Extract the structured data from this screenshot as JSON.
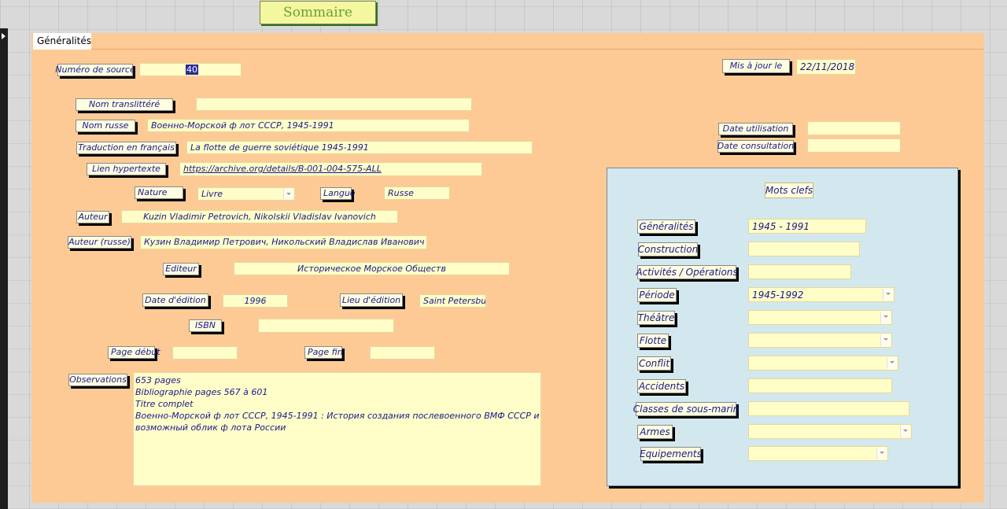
{
  "nav": {
    "sommaire_label": "Sommaire"
  },
  "tab": {
    "label": "Généralités"
  },
  "form": {
    "source_num": {
      "label": "Numéro de source",
      "value": "40"
    },
    "updated": {
      "label": "Mis à jour le",
      "value": "22/11/2018"
    },
    "nom_translit": {
      "label": "Nom translittéré",
      "value": ""
    },
    "nom_russe": {
      "label": "Nom russe",
      "value": "Военно-Морской ф лот СССР, 1945-1991"
    },
    "traduction": {
      "label": "Traduction en français",
      "value": "La flotte de guerre soviétique 1945-1991"
    },
    "lien": {
      "label": "Lien hypertexte",
      "value": "https://archive.org/details/B-001-004-575-ALL"
    },
    "nature": {
      "label": "Nature",
      "value": "Livre"
    },
    "langue": {
      "label": "Langue",
      "value": "Russe"
    },
    "auteur": {
      "label": "Auteur",
      "value": "Kuzin Vladimir Petrovich, Nikolskii Vladislav Ivanovich"
    },
    "auteur_russe": {
      "label": "Auteur (russe)",
      "value": "Кузин Владимир Петрович, Никольский Владислав Иванович"
    },
    "editeur": {
      "label": "Editeur",
      "value": "Историческое Морское Обществ"
    },
    "date_edition": {
      "label": "Date d'édition",
      "value": "1996"
    },
    "lieu_edition": {
      "label": "Lieu  d'édition",
      "value": "Saint Petersburg"
    },
    "isbn": {
      "label": "ISBN",
      "value": ""
    },
    "page_debut": {
      "label": "Page début",
      "value": ""
    },
    "page_fin": {
      "label": "Page fin",
      "value": ""
    },
    "date_utilisation": {
      "label": "Date utilisation",
      "value": ""
    },
    "date_consultation": {
      "label": "Date consultation",
      "value": ""
    },
    "observations": {
      "label": "Observations",
      "lines": [
        "653 pages",
        "Bibliographie pages 567 à 601",
        "Titre complet",
        "Военно-Морской ф лот СССР, 1945-1991 : История создания послевоенного ВМФ СССР и",
        "возможный облик ф лота России"
      ]
    }
  },
  "keywords": {
    "title": "Mots clefs",
    "generalites": {
      "label": "Généralités",
      "value": "1945 - 1991"
    },
    "construction": {
      "label": "Construction",
      "value": ""
    },
    "activites": {
      "label": "Activités / Opérations",
      "value": ""
    },
    "periode": {
      "label": "Période",
      "value": "1945-1992"
    },
    "theatre": {
      "label": "Théâtre",
      "value": ""
    },
    "flotte": {
      "label": "Flotte",
      "value": ""
    },
    "conflit": {
      "label": "Conflit",
      "value": ""
    },
    "accidents": {
      "label": "Accidents",
      "value": ""
    },
    "classes": {
      "label": "Classes de sous-marin",
      "value": ""
    },
    "armes": {
      "label": "Armes",
      "value": ""
    },
    "equipements": {
      "label": "Equipements",
      "value": ""
    }
  },
  "colors": {
    "form_bg": "#fdca96",
    "panel_bg": "#d2e8ee",
    "field_bg": "#fffdc8",
    "label_text": "#1a1a8c",
    "sommaire_text": "#6aa22a"
  },
  "icons": [
    "dropdown-arrow-icon",
    "record-selector-icon"
  ]
}
